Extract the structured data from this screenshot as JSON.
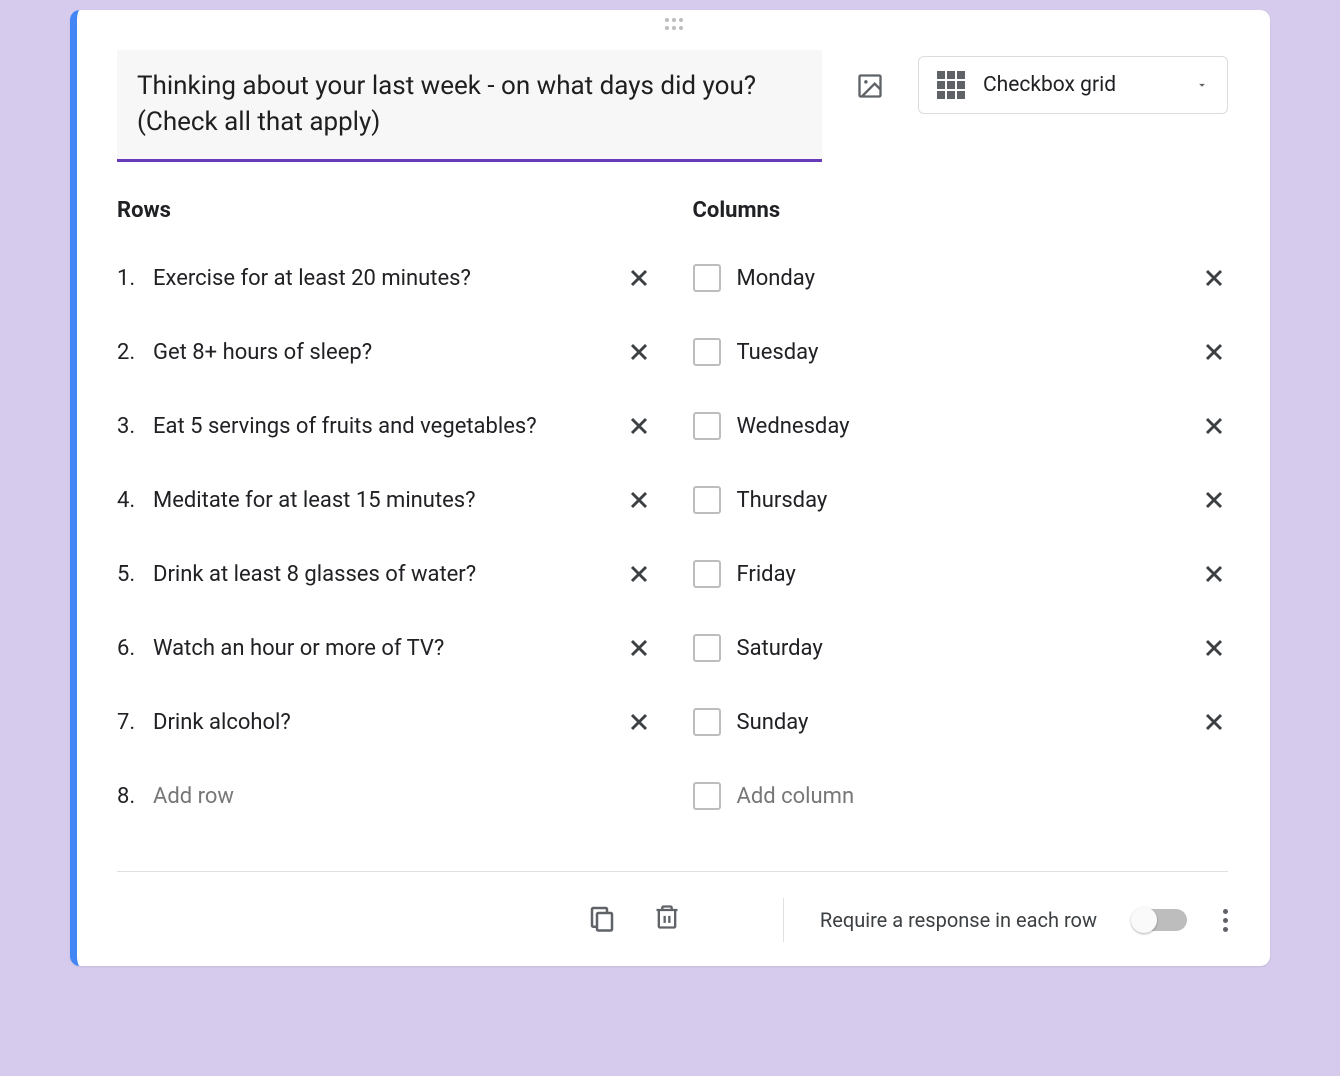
{
  "question": "Thinking about your last week - on what days did you? (Check all that apply)",
  "questionType": "Checkbox grid",
  "rowsLabel": "Rows",
  "columnsLabel": "Columns",
  "rows": [
    "Exercise for at least 20 minutes?",
    "Get 8+ hours of sleep?",
    "Eat 5 servings of fruits and vegetables?",
    "Meditate for at least 15 minutes?",
    "Drink at least 8 glasses of water?",
    "Watch an hour or more of TV?",
    "Drink alcohol?"
  ],
  "addRowPlaceholder": "Add row",
  "addRowNumber": "8.",
  "columns": [
    "Monday",
    "Tuesday",
    "Wednesday",
    "Thursday",
    "Friday",
    "Saturday",
    "Sunday"
  ],
  "addColumnPlaceholder": "Add column",
  "footer": {
    "requireLabel": "Require a response in each row",
    "requireOn": false
  }
}
